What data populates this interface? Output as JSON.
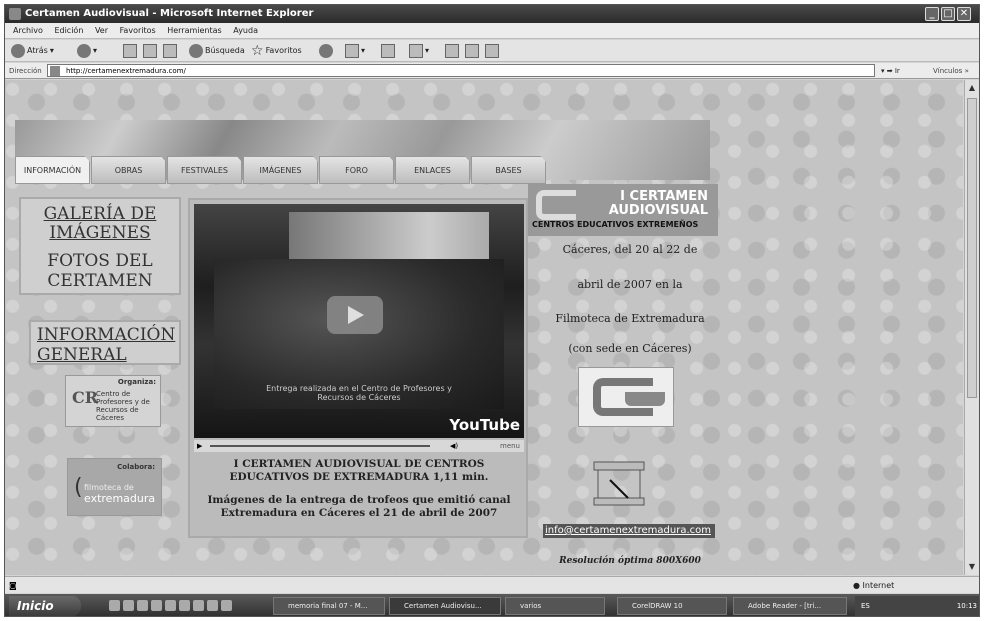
{
  "window": {
    "title": "Certamen Audiovisual - Microsoft Internet Explorer"
  },
  "menubar": {
    "items": [
      "Archivo",
      "Edición",
      "Ver",
      "Favoritos",
      "Herramientas",
      "Ayuda"
    ]
  },
  "toolbar": {
    "back": "Atrás",
    "search": "Búsqueda",
    "favorites": "Favoritos"
  },
  "addressbar": {
    "label": "Dirección",
    "url": "http://certamenextremadura.com/",
    "go": "Ir",
    "links": "Vínculos"
  },
  "site": {
    "tabs": [
      "INFORMACIÓN",
      "OBRAS",
      "FESTIVALES",
      "IMÁGENES",
      "FORO",
      "ENLACES",
      "BASES"
    ],
    "gallery": {
      "line1": "GALERÍA DE",
      "line2": "IMÁGENES",
      "line3": "FOTOS DEL",
      "line4": "CERTAMEN"
    },
    "info": {
      "line1": "INFORMACIÓN",
      "line2": "GENERAL"
    },
    "org_logo": {
      "label": "Organiza:",
      "text": "Centro de Profesores y de Recursos de Cáceres"
    },
    "col_logo": {
      "label": "Colabora:",
      "text1": "filmoteca de",
      "text2": "extremadura"
    },
    "video": {
      "overlay": "Entrega realizada en el Centro de Profesores y Recursos de Cáceres",
      "logo": "YouTube",
      "menu": "menu"
    },
    "caption": {
      "title": "I CERTAMEN AUDIOVISUAL DE CENTROS EDUCATIVOS DE EXTREMADURA 1,11 min.",
      "desc": "Imágenes de la entrega de trofeos que emitió canal Extremadura en Cáceres el 21 de abril de 2007"
    },
    "right_logo": {
      "line1": "I CERTAMEN",
      "line2": "AUDIOVISUAL",
      "line3": "CENTROS EDUCATIVOS EXTREMEÑOS"
    },
    "right_text": [
      "Cáceres, del 20 al 22 de",
      "abril de 2007 en la",
      "Filmoteca de Extremadura",
      "(con sede en Cáceres)"
    ],
    "email": "info@certamenextremadura.com",
    "resolution": "Resolución óptima 800X600"
  },
  "statusbar": {
    "zone": "Internet"
  },
  "taskbar": {
    "start": "Inicio",
    "tasks": [
      "memoria final 07 - M...",
      "Certamen Audiovisu...",
      "varios",
      "CorelDRAW 10",
      "Adobe Reader - [tri..."
    ],
    "lang": "ES",
    "clock": "10:13"
  }
}
